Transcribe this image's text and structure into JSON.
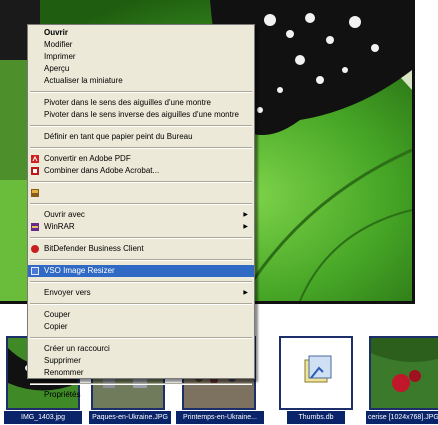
{
  "menu": {
    "items": [
      {
        "label": "Ouvrir",
        "bold": true
      },
      {
        "label": "Modifier"
      },
      {
        "label": "Imprimer"
      },
      {
        "label": "Aperçu"
      },
      {
        "label": "Actualiser la miniature"
      },
      {
        "sep": true
      },
      {
        "label": "Pivoter dans le sens des aiguilles d'une montre"
      },
      {
        "label": "Pivoter dans le sens inverse des aiguilles d'une montre"
      },
      {
        "sep": true
      },
      {
        "label": "Définir en tant que papier peint du Bureau"
      },
      {
        "sep": true
      },
      {
        "label": "Convertir en Adobe PDF",
        "icon": "adobe-pdf-icon"
      },
      {
        "label": "Combiner dans Adobe Acrobat...",
        "icon": "adobe-acrobat-icon"
      },
      {
        "sep": true
      },
      {
        "label": "",
        "icon": "shell-extension-icon"
      },
      {
        "sep": true
      },
      {
        "label": "Ouvrir avec",
        "submenu": true
      },
      {
        "label": "WinRAR",
        "icon": "winrar-icon",
        "submenu": true
      },
      {
        "sep": true
      },
      {
        "label": "BitDefender Business Client",
        "icon": "bitdefender-icon"
      },
      {
        "sep": true
      },
      {
        "label": "VSO Image Resizer",
        "icon": "vso-image-resizer-icon",
        "selected": true
      },
      {
        "sep": true
      },
      {
        "label": "Envoyer vers",
        "submenu": true
      },
      {
        "sep": true
      },
      {
        "label": "Couper"
      },
      {
        "label": "Copier"
      },
      {
        "sep": true
      },
      {
        "label": "Créer un raccourci"
      },
      {
        "label": "Supprimer"
      },
      {
        "label": "Renommer"
      },
      {
        "sep": true
      },
      {
        "label": "Propriétés"
      }
    ]
  },
  "thumbnails": [
    {
      "caption": "IMG_1403.jpg"
    },
    {
      "caption": "Paques-en-Ukraine.JPG"
    },
    {
      "caption": "Printemps-en-Ukraine..."
    },
    {
      "caption": "Thumbs.db"
    },
    {
      "caption": "cerise [1024x768].JPG"
    }
  ],
  "colors": {
    "menu_bg": "#ece9d8",
    "selection": "#316ac5",
    "caption_bg": "#0a246a"
  }
}
